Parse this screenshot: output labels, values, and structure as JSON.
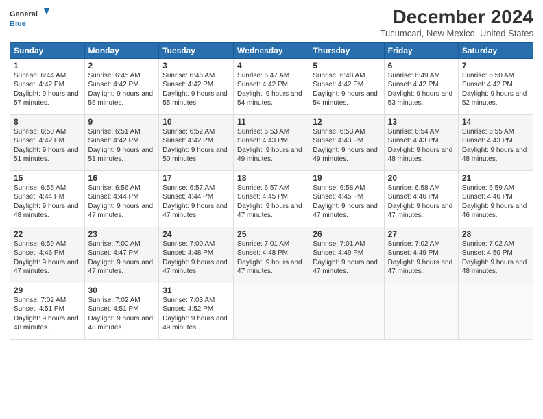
{
  "header": {
    "logo_line1": "General",
    "logo_line2": "Blue",
    "month_title": "December 2024",
    "location": "Tucumcari, New Mexico, United States"
  },
  "weekdays": [
    "Sunday",
    "Monday",
    "Tuesday",
    "Wednesday",
    "Thursday",
    "Friday",
    "Saturday"
  ],
  "weeks": [
    [
      {
        "day": "1",
        "sunrise": "6:44 AM",
        "sunset": "4:42 PM",
        "daylight": "9 hours and 57 minutes."
      },
      {
        "day": "2",
        "sunrise": "6:45 AM",
        "sunset": "4:42 PM",
        "daylight": "9 hours and 56 minutes."
      },
      {
        "day": "3",
        "sunrise": "6:46 AM",
        "sunset": "4:42 PM",
        "daylight": "9 hours and 55 minutes."
      },
      {
        "day": "4",
        "sunrise": "6:47 AM",
        "sunset": "4:42 PM",
        "daylight": "9 hours and 54 minutes."
      },
      {
        "day": "5",
        "sunrise": "6:48 AM",
        "sunset": "4:42 PM",
        "daylight": "9 hours and 54 minutes."
      },
      {
        "day": "6",
        "sunrise": "6:49 AM",
        "sunset": "4:42 PM",
        "daylight": "9 hours and 53 minutes."
      },
      {
        "day": "7",
        "sunrise": "6:50 AM",
        "sunset": "4:42 PM",
        "daylight": "9 hours and 52 minutes."
      }
    ],
    [
      {
        "day": "8",
        "sunrise": "6:50 AM",
        "sunset": "4:42 PM",
        "daylight": "9 hours and 51 minutes."
      },
      {
        "day": "9",
        "sunrise": "6:51 AM",
        "sunset": "4:42 PM",
        "daylight": "9 hours and 51 minutes."
      },
      {
        "day": "10",
        "sunrise": "6:52 AM",
        "sunset": "4:42 PM",
        "daylight": "9 hours and 50 minutes."
      },
      {
        "day": "11",
        "sunrise": "6:53 AM",
        "sunset": "4:43 PM",
        "daylight": "9 hours and 49 minutes."
      },
      {
        "day": "12",
        "sunrise": "6:53 AM",
        "sunset": "4:43 PM",
        "daylight": "9 hours and 49 minutes."
      },
      {
        "day": "13",
        "sunrise": "6:54 AM",
        "sunset": "4:43 PM",
        "daylight": "9 hours and 48 minutes."
      },
      {
        "day": "14",
        "sunrise": "6:55 AM",
        "sunset": "4:43 PM",
        "daylight": "9 hours and 48 minutes."
      }
    ],
    [
      {
        "day": "15",
        "sunrise": "6:55 AM",
        "sunset": "4:44 PM",
        "daylight": "9 hours and 48 minutes."
      },
      {
        "day": "16",
        "sunrise": "6:56 AM",
        "sunset": "4:44 PM",
        "daylight": "9 hours and 47 minutes."
      },
      {
        "day": "17",
        "sunrise": "6:57 AM",
        "sunset": "4:44 PM",
        "daylight": "9 hours and 47 minutes."
      },
      {
        "day": "18",
        "sunrise": "6:57 AM",
        "sunset": "4:45 PM",
        "daylight": "9 hours and 47 minutes."
      },
      {
        "day": "19",
        "sunrise": "6:58 AM",
        "sunset": "4:45 PM",
        "daylight": "9 hours and 47 minutes."
      },
      {
        "day": "20",
        "sunrise": "6:58 AM",
        "sunset": "4:46 PM",
        "daylight": "9 hours and 47 minutes."
      },
      {
        "day": "21",
        "sunrise": "6:59 AM",
        "sunset": "4:46 PM",
        "daylight": "9 hours and 46 minutes."
      }
    ],
    [
      {
        "day": "22",
        "sunrise": "6:59 AM",
        "sunset": "4:46 PM",
        "daylight": "9 hours and 47 minutes."
      },
      {
        "day": "23",
        "sunrise": "7:00 AM",
        "sunset": "4:47 PM",
        "daylight": "9 hours and 47 minutes."
      },
      {
        "day": "24",
        "sunrise": "7:00 AM",
        "sunset": "4:48 PM",
        "daylight": "9 hours and 47 minutes."
      },
      {
        "day": "25",
        "sunrise": "7:01 AM",
        "sunset": "4:48 PM",
        "daylight": "9 hours and 47 minutes."
      },
      {
        "day": "26",
        "sunrise": "7:01 AM",
        "sunset": "4:49 PM",
        "daylight": "9 hours and 47 minutes."
      },
      {
        "day": "27",
        "sunrise": "7:02 AM",
        "sunset": "4:49 PM",
        "daylight": "9 hours and 47 minutes."
      },
      {
        "day": "28",
        "sunrise": "7:02 AM",
        "sunset": "4:50 PM",
        "daylight": "9 hours and 48 minutes."
      }
    ],
    [
      {
        "day": "29",
        "sunrise": "7:02 AM",
        "sunset": "4:51 PM",
        "daylight": "9 hours and 48 minutes."
      },
      {
        "day": "30",
        "sunrise": "7:02 AM",
        "sunset": "4:51 PM",
        "daylight": "9 hours and 48 minutes."
      },
      {
        "day": "31",
        "sunrise": "7:03 AM",
        "sunset": "4:52 PM",
        "daylight": "9 hours and 49 minutes."
      },
      null,
      null,
      null,
      null
    ]
  ]
}
